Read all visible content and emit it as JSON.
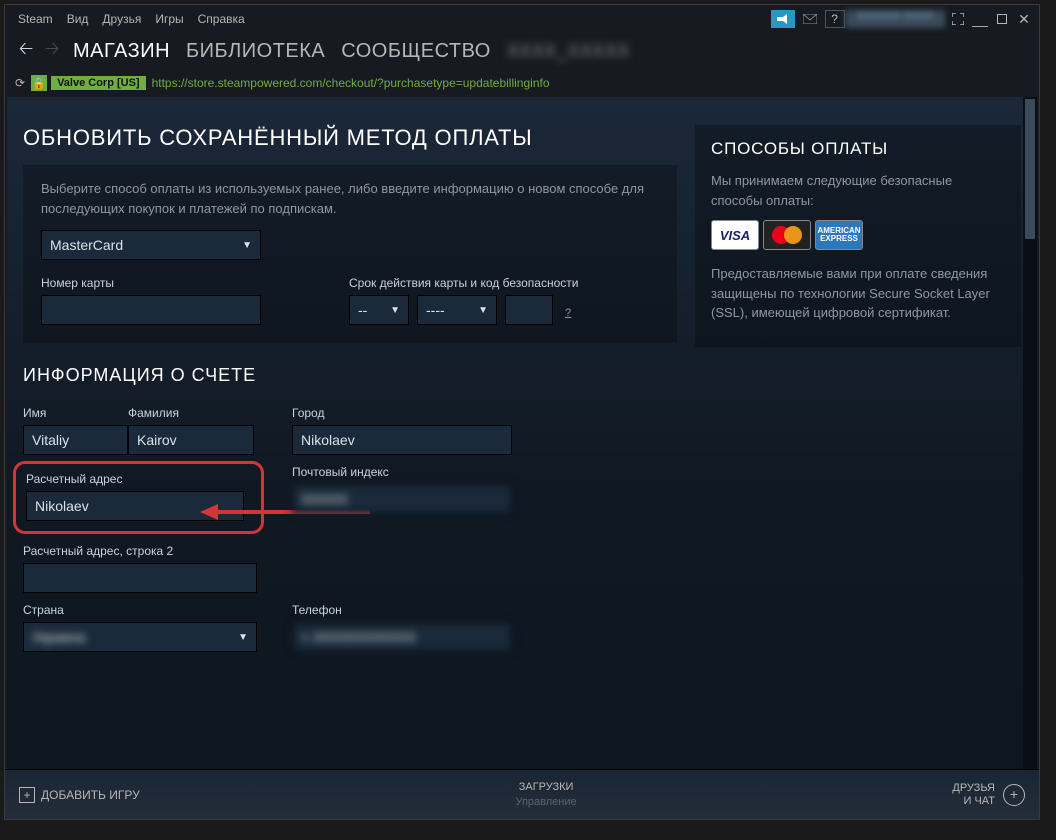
{
  "titlebar": {
    "menu": [
      "Steam",
      "Вид",
      "Друзья",
      "Игры",
      "Справка"
    ],
    "username_blurred": "XXXXXX XXXX"
  },
  "nav": {
    "tabs": [
      "МАГАЗИН",
      "БИБЛИОТЕКА",
      "СООБЩЕСТВО"
    ],
    "user_blurred": "XXXX_XXXXX"
  },
  "urlbar": {
    "badge": "Valve Corp [US]",
    "url": "https://store.steampowered.com/checkout/?purchasetype=updatebillinginfo"
  },
  "page": {
    "title": "ОБНОВИТЬ СОХРАНЁННЫЙ МЕТОД ОПЛАТЫ",
    "intro": "Выберите способ оплаты из используемых ранее, либо введите информацию о новом способе для последующих покупок и платежей по подпискам.",
    "payment_method": "MasterCard",
    "card_number_label": "Номер карты",
    "expiry_label": "Срок действия карты и код безопасности",
    "expiry_mm": "--",
    "expiry_yy": "----",
    "cvv": "",
    "billing_title": "ИНФОРМАЦИЯ О СЧЕТЕ",
    "first_name_label": "Имя",
    "first_name": "Vitaliy",
    "last_name_label": "Фамилия",
    "last_name": "Kairov",
    "city_label": "Город",
    "city": "Nikolaev",
    "billing_addr_label": "Расчетный адрес",
    "billing_addr": "Nikolaev",
    "postal_label": "Почтовый индекс",
    "postal_blurred": "XXXXX",
    "billing_addr2_label": "Расчетный адрес, строка 2",
    "country_label": "Страна",
    "country_blurred": "Украина",
    "phone_label": "Телефон",
    "phone_blurred": "+ XXXXXXXXXXX"
  },
  "sidebar": {
    "title": "СПОСОБЫ ОПЛАТЫ",
    "accept_text": "Мы принимаем следующие безопасные способы оплаты:",
    "ssl_text": "Предоставляемые вами при оплате сведения защищены по технологии Secure Socket Layer (SSL), имеющей цифровой сертификат."
  },
  "footer": {
    "add_game": "ДОБАВИТЬ ИГРУ",
    "downloads": "ЗАГРУЗКИ",
    "downloads_sub": "Управление",
    "friends": "ДРУЗЬЯ\nИ ЧАТ"
  }
}
